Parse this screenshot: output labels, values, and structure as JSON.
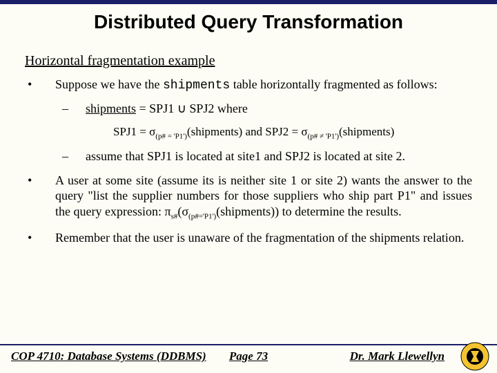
{
  "header": {
    "title": "Distributed Query Transformation"
  },
  "subheading": "Horizontal fragmentation example",
  "bullets": {
    "item1_prefix": "Suppose we have the ",
    "item1_code": "shipments",
    "item1_suffix": " table horizontally fragmented as follows:",
    "sub1_prefix": "shipments",
    "sub1_mid": " = SPJ1 ",
    "sub1_union": "∪",
    "sub1_post": " SPJ2 where",
    "formula_spj1": "SPJ1 = ",
    "formula_sigma1": "σ",
    "formula_sub1": "(p# = 'P1')",
    "formula_ship1": "(shipments)",
    "formula_and": "  and  ",
    "formula_spj2": "SPJ2 = ",
    "formula_sigma2": "σ",
    "formula_sub2": "(p# ≠ 'P1')",
    "formula_ship2": "(shipments)",
    "sub2": "assume that SPJ1 is located at site1 and SPJ2 is located at site 2.",
    "item2_prefix": "A user at some site (assume its is neither site 1 or site 2) wants the answer to the query \"list the supplier numbers for those suppliers who ship part P1\" and issues the query expression: ",
    "item2_pi": "π",
    "item2_pisub": "s#",
    "item2_open": "(",
    "item2_sigma": "σ",
    "item2_sigsub": "(p#='P1')",
    "item2_ship": "(shipments)",
    "item2_close": ")",
    "item2_suffix": " to determine the results.",
    "item3": "Remember that the user is unaware of the fragmentation of the shipments relation."
  },
  "footer": {
    "course": "COP 4710: Database Systems  (DDBMS)",
    "page": "Page 73",
    "author": "Dr. Mark Llewellyn"
  }
}
